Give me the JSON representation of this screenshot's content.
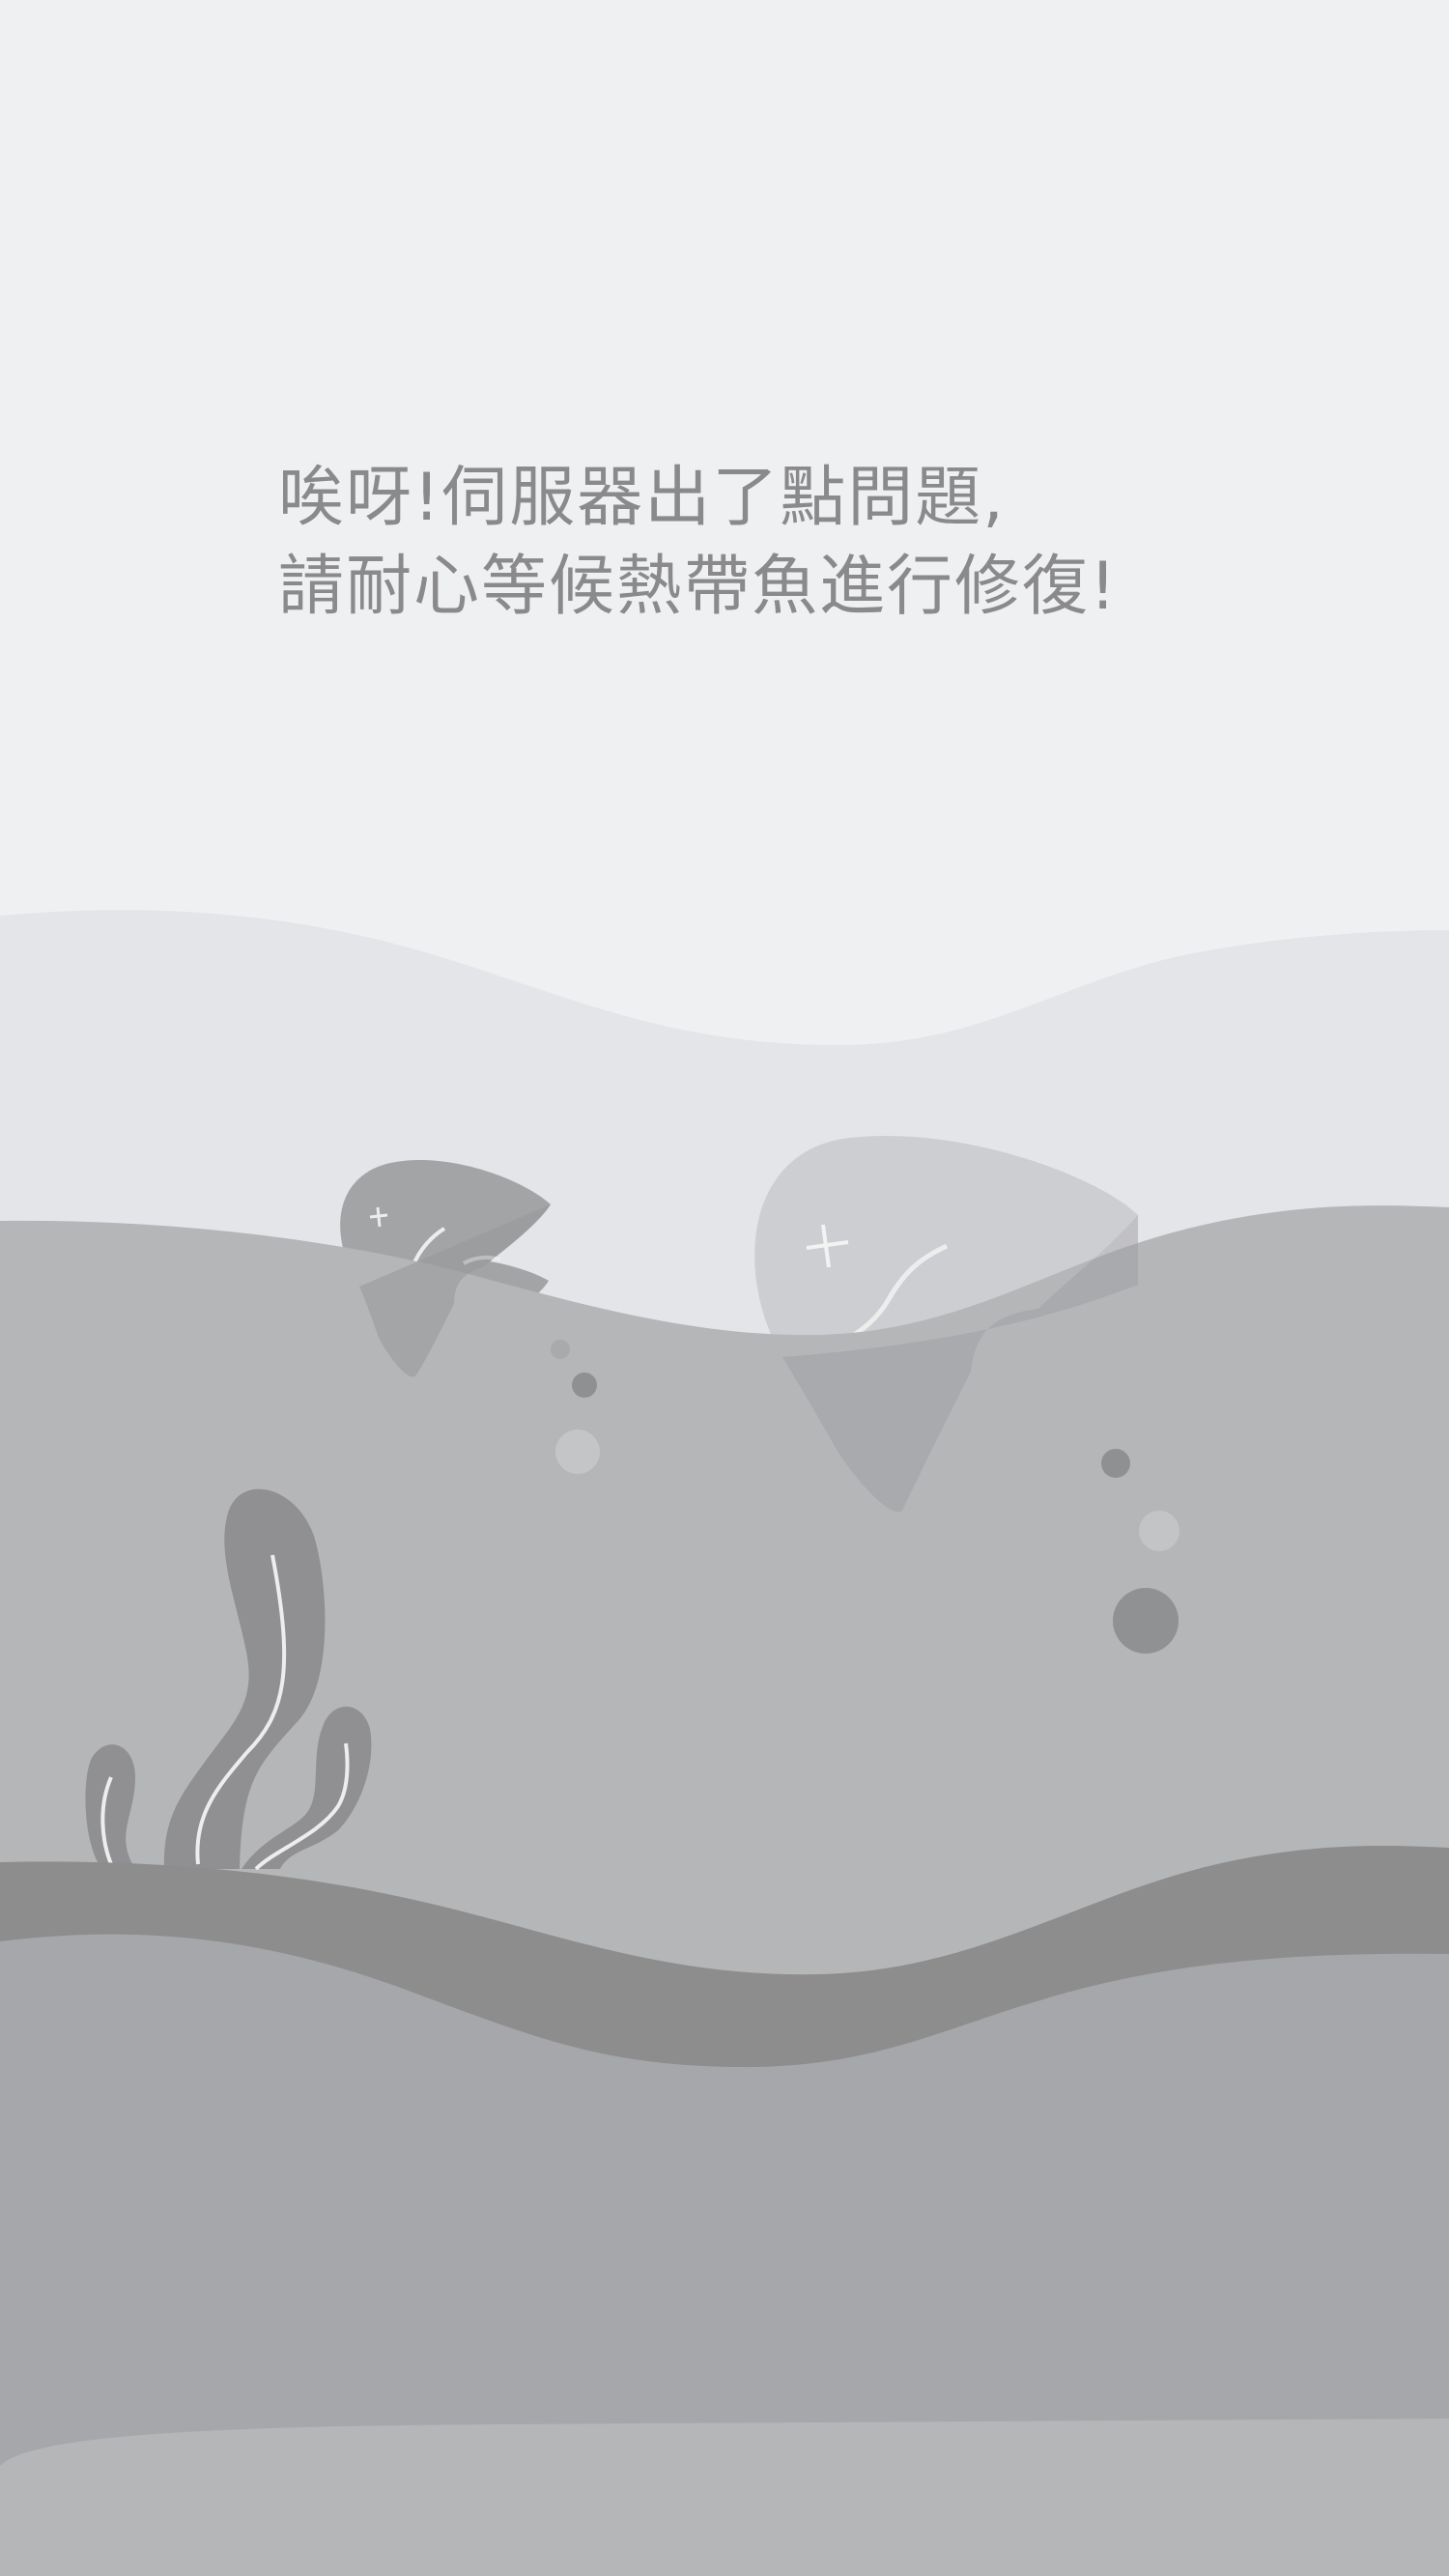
{
  "error_message": {
    "line1": "唉呀!伺服器出了點問題,",
    "line2": "請耐心等候熱帶魚進行修復!"
  },
  "illustration": {
    "subject": "underwater scene with fish, bubbles and seaweed",
    "icons": [
      "fish-icon",
      "fish-icon",
      "bubble-icon",
      "seaweed-icon"
    ]
  },
  "colors": {
    "background": "#eff0f2",
    "text": "#8a8a8c",
    "wave_light": "#e4e5e8",
    "wave_mid": "#b5b6b8",
    "wave_dark": "#8d8d8d",
    "seabed": "#a6a7aa",
    "fish": "#a3a4a6"
  }
}
